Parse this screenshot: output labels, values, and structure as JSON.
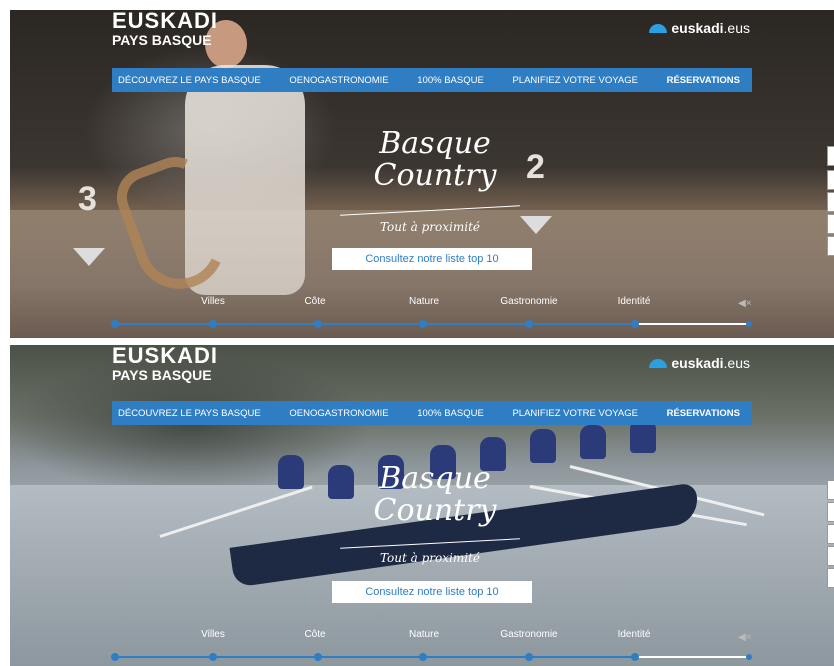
{
  "header": {
    "logo_line1": "EUSKADI",
    "logo_line2": "PAYS BASQUE",
    "euskadi_bold": "euskadi",
    "euskadi_suffix": ".eus"
  },
  "nav": [
    {
      "label": "DÉCOUVREZ LE PAYS BASQUE",
      "bold": false
    },
    {
      "label": "OENOGASTRONOMIE",
      "bold": false
    },
    {
      "label": "100% BASQUE",
      "bold": false
    },
    {
      "label": "PLANIFIEZ VOTRE VOYAGE",
      "bold": false
    },
    {
      "label": "RÉSERVATIONS",
      "bold": true
    }
  ],
  "hero": {
    "title_line1": "Basque",
    "title_line2": "Country",
    "tagline": "Tout à proximité",
    "cta": "Consultez notre liste top 10"
  },
  "slider": {
    "categories": [
      "Villes",
      "Côte",
      "Nature",
      "Gastronomie",
      "Identité"
    ],
    "mute_icon": "speaker-mute-icon"
  },
  "panel1": {
    "wall_numbers": [
      "3",
      "2"
    ]
  },
  "colors": {
    "nav_blue": "#2f7ec3",
    "accent": "#2aa0e0"
  }
}
